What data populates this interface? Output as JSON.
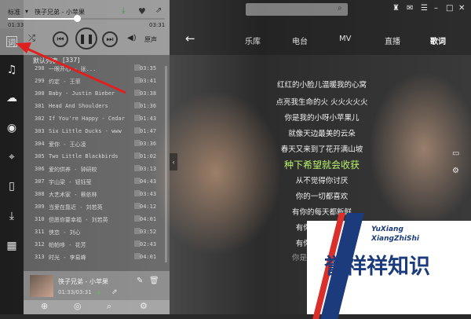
{
  "top": {
    "quality_label": "标准",
    "dropdown_arrow": "▾",
    "now_playing": "筷子兄弟 - 小苹果",
    "elapsed": "01:33",
    "total": "03:31",
    "search_placeholder": ""
  },
  "controls": {
    "source_label": "原声"
  },
  "nav": {
    "items": [
      "乐库",
      "电台",
      "MV",
      "直播",
      "歌词"
    ],
    "active": "歌词"
  },
  "playlist": {
    "title": "默认列表",
    "count": "[337]",
    "rows": [
      {
        "num": "298",
        "name": "一眼开心 - 张...",
        "dur": "03:35"
      },
      {
        "num": "299",
        "name": "约定 - 王菲",
        "dur": "03:41"
      },
      {
        "num": "300",
        "name": "Baby - Justin Bieber",
        "dur": "03:38"
      },
      {
        "num": "301",
        "name": "Head And Shoulders",
        "dur": "01:36"
      },
      {
        "num": "302",
        "name": "If You're Happy - Cedar",
        "dur": "01:43"
      },
      {
        "num": "303",
        "name": "Six Little Ducks - www",
        "dur": "01:47"
      },
      {
        "num": "304",
        "name": "爱你 - 王心凌",
        "dur": "03:36"
      },
      {
        "num": "305",
        "name": "Two Little Blackbirds",
        "dur": "01:02"
      },
      {
        "num": "306",
        "name": "爱的供养 - 钟研皎",
        "dur": "03:13"
      },
      {
        "num": "307",
        "name": "宇山梁 - 钮钰莹",
        "dur": "04:43"
      },
      {
        "num": "308",
        "name": "大艺术家 - 蔡依林",
        "dur": "03:43"
      },
      {
        "num": "309",
        "name": "当爱在靠近 - 刘若英",
        "dur": "04:12"
      },
      {
        "num": "310",
        "name": "但愿你要幸福 - 刘若英",
        "dur": "04:01"
      },
      {
        "num": "311",
        "name": "侠恋 - 刘心",
        "dur": "03:52"
      },
      {
        "num": "312",
        "name": "帕帕哆 - 花芳",
        "dur": "02:43"
      },
      {
        "num": "313",
        "name": "时光 - 李易峰",
        "dur": "04:01"
      }
    ]
  },
  "mini_player": {
    "title": "筷子兄弟 - 小苹果",
    "time": "01:33/03:31"
  },
  "lyrics": [
    "红红的小脸儿温暖我的心窝",
    "点亮我生命的火 火火火火火",
    "你是我的小呀小苹果儿",
    "就像天边最美的云朵",
    "春天又来到了花开满山坡",
    "种下希望就会收获",
    "从不觉得你讨厌",
    "你的一切都喜欢",
    "有你的每天都新鲜",
    "有你阳光更灿烂",
    "有你黑夜不黑暗",
    "你是白云我是蓝天"
  ],
  "brand": {
    "en1": "YuXiang",
    "en2": "XiangZhiShi",
    "cn": "誉祥祥知识"
  },
  "colors": {
    "lyric_highlight": "#b8f26a",
    "brand_blue": "#1b3b7c",
    "brand_red": "#d9302b",
    "arrow_red": "#e02020"
  }
}
